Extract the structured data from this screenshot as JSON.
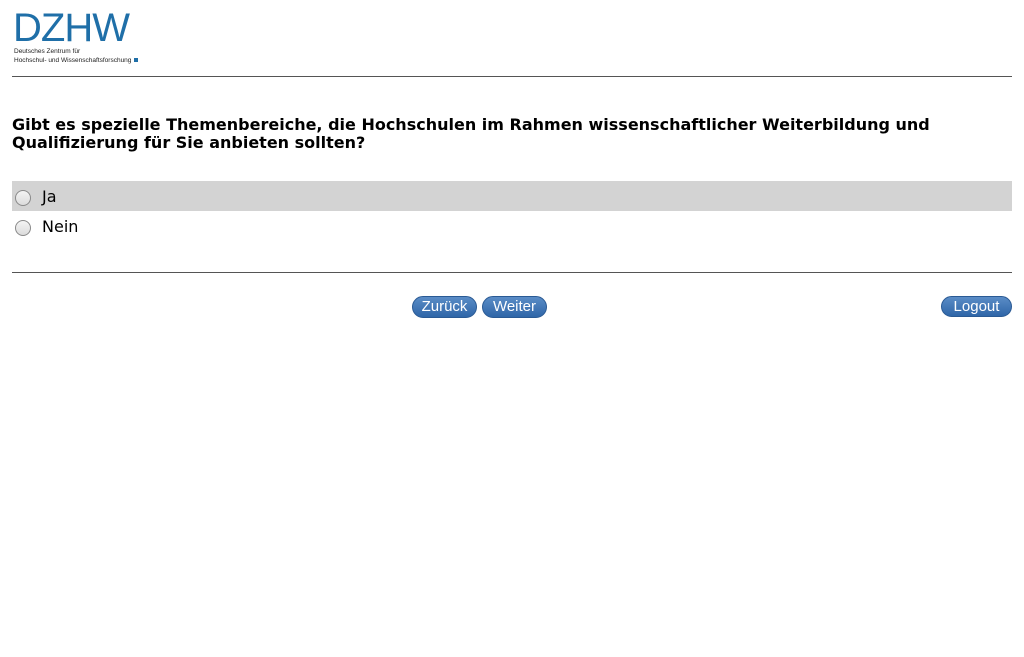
{
  "logo": {
    "letters": "DZHW",
    "line1": "Deutsches Zentrum für",
    "line2": "Hochschul- und Wissenschaftsforschung"
  },
  "question": {
    "text": "Gibt es spezielle Themenbereiche, die Hochschulen im Rahmen wissenschaftlicher Weiterbildung und Qualifizierung für Sie anbieten sollten?"
  },
  "options": [
    {
      "label": "Ja",
      "selected": false,
      "highlighted": true
    },
    {
      "label": "Nein",
      "selected": false,
      "highlighted": false
    }
  ],
  "navigation": {
    "back_label": "Zurück",
    "next_label": "Weiter",
    "logout_label": "Logout"
  },
  "colors": {
    "brand": "#1f6fa8",
    "button": "#3a6fb0",
    "highlight": "#d3d3d3"
  }
}
